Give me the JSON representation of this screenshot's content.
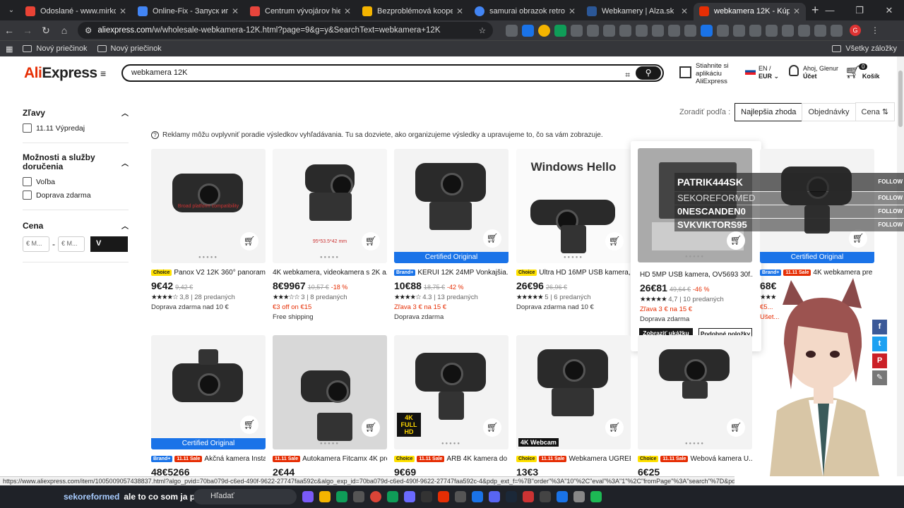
{
  "browser": {
    "tabs": [
      {
        "title": "Odoslané - www.mirkomali1234",
        "color": "#ea4335"
      },
      {
        "title": "Online-Fix - Запуск игр по сети",
        "color": "#4285f4"
      },
      {
        "title": "Centrum vývojárov hier podobných",
        "color": "#e8453c"
      },
      {
        "title": "Bezproblémová kooperácia (Ele",
        "color": "#f4b400"
      },
      {
        "title": "samurai obrazok retro - Hľadať",
        "color": "#4285f4"
      },
      {
        "title": "Webkamery | Alza.sk",
        "color": "#2b5797"
      },
      {
        "title": "webkamera 12K - Kúpte si webka",
        "color": "#e62e04"
      }
    ],
    "url_host": "aliexpress.com",
    "url_rest": "/w/wholesale-webkamera-12K.html?page=9&g=y&SearchText=webkamera+12K",
    "bookmarks": [
      "Nový priečinok",
      "Nový priečinok"
    ],
    "all_bookmarks": "Všetky záložky",
    "profile_letter": "G"
  },
  "header": {
    "logo_a": "Ali",
    "logo_b": "Express",
    "search_value": "webkamera 12K",
    "app_line1": "Stiahnite si",
    "app_line2": "aplikáciu",
    "app_line3": "AliExpress",
    "lang": "EN /",
    "currency": "EUR ⌄",
    "greeting": "Ahoj, Glenur",
    "account": "Účet",
    "cart_count": "0",
    "cart_label": "Košík"
  },
  "filters": {
    "deals": "Zľavy",
    "deal_item": "11.11 Výpredaj",
    "services": "Možnosti a služby doručenia",
    "svc1": "Voľba",
    "svc2": "Doprava zdarma",
    "price": "Cena",
    "min": "€ M...",
    "max": "€ M...",
    "go": "V"
  },
  "sort": {
    "label": "Zoradiť podľa :",
    "opt1": "Najlepšia zhoda",
    "opt2": "Objednávky",
    "opt3": "Cena ⇅"
  },
  "notice": "Reklamy môžu ovplyvniť poradie výsledkov vyhľadávania. Tu sa dozviete, ako organizujeme výsledky a upravujeme to, čo sa vám zobrazuje.",
  "products": [
    {
      "badge": "Choice",
      "title": "Panox V2 12K 360° panoram...",
      "price": "9€42",
      "old": "9,42 €",
      "disc": "",
      "rating": "3,8",
      "sold": "28 predaných",
      "extra": "Doprava zdarma nad 10 €",
      "extra2": "",
      "img_text": "",
      "note": "Broad platform compatibility"
    },
    {
      "badge": "",
      "title": "4K webkamera, videokamera s 2K a...",
      "price": "8€9967",
      "old": "10,57 €",
      "disc": "-18 %",
      "rating": "3",
      "sold": "8 predaných",
      "extra": "€3 off on €15",
      "extra2": "Free shipping",
      "img_text": "",
      "note": "95*53.5*42 mm"
    },
    {
      "badge": "Brand+",
      "title": "KERUI 12K 24MP Vonkajšia...",
      "price": "10€88",
      "old": "18,75 €",
      "disc": "-42 %",
      "rating": "4.3",
      "sold": "13 predaných",
      "extra": "Zľava 3 € na 15 €",
      "extra2": "Doprava zdarma",
      "img_text": "",
      "note": "Certified Original"
    },
    {
      "badge": "Choice",
      "title": "Ultra HD 16MP USB kamera, ...",
      "price": "26€96",
      "old": "26,96 €",
      "disc": "",
      "rating": "5",
      "sold": "6 predaných",
      "extra": "Doprava zdarma nad 10 €",
      "extra2": "",
      "img_text": "Windows Hello",
      "note": ""
    },
    {
      "badge": "",
      "title": "HD 5MP USB kamera, OV5693 30f...",
      "price": "26€81",
      "old": "49,64 €",
      "disc": "-46 %",
      "rating": "4,7",
      "sold": "10 predaných",
      "extra": "Zľava 3 € na 15 €",
      "extra2": "Doprava zdarma",
      "img_text": "",
      "note": ""
    },
    {
      "badge": "11.11 Sale",
      "title": "4K webkamera pre PC...",
      "price": "68€",
      "old": "",
      "disc": "",
      "rating": "",
      "sold": "",
      "extra": "€5...",
      "extra2": "Ušet...",
      "img_text": "",
      "note": "Certified Original"
    },
    {
      "badge": "Brand+",
      "title": "Akčná kamera Insta36...",
      "price": "48€5266",
      "note": "Certified Original"
    },
    {
      "badge": "11.11 Sale",
      "title": "Autokamera Fitcamx 4K pre ...",
      "price": "2€44",
      "note": ""
    },
    {
      "badge": "Choice",
      "title": "ARB 4K kamera do aut...",
      "price": "9€69",
      "note": "4K FULL HD"
    },
    {
      "badge": "11.11 Sale",
      "title": "Webkamera UGREEN...",
      "price": "13€3",
      "note": "4K Webcam"
    },
    {
      "badge": "Choice",
      "title": "Webová kamera U...",
      "price": "6€25",
      "note": ""
    }
  ],
  "hover": {
    "btn1": "Zobraziť ukážku",
    "btn2": "Podobné položky"
  },
  "overlay": [
    {
      "name": "PATRIK444SK",
      "follow": "FOLLOW"
    },
    {
      "name": "SEKOREFORMED",
      "follow": "FOLLOW"
    },
    {
      "name": "0NESCANDEN0",
      "follow": "FOLLOW"
    },
    {
      "name": "SVKVIKTORS95",
      "follow": "FOLLOW"
    }
  ],
  "status_url": "https://www.aliexpress.com/item/1005009057438837.html?algo_pvid=70ba079d-c6ed-490f-9622-27747faa592c&algo_exp_id=70ba079d-c6ed-490f-9622-27747faa592c-4&pdp_ext_f=%7B\"order\"%3A\"10\"%2C\"eval\"%3A\"1\"%2C\"fromPage\"%3A\"search\"%7D&pdp_npi=6%40dis%21EUR%2149.6",
  "taskbar": {
    "chat_user": "sekoreformed",
    "chat_msg": "ale to co som ja poslal",
    "search": "Hľadať"
  }
}
